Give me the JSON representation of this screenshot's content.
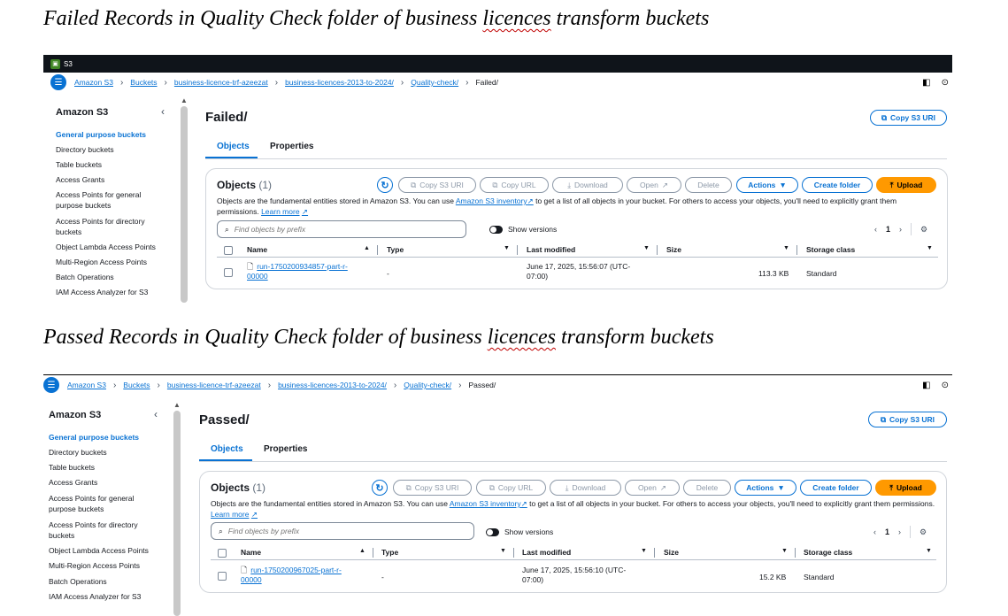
{
  "captions": {
    "failed": {
      "before": "Failed Records in Quality Check folder of business ",
      "squiggle": "licences",
      "after": " transform buckets"
    },
    "passed": {
      "before": "Passed Records in Quality Check folder of business ",
      "squiggle": "licences",
      "after": " transform buckets"
    }
  },
  "top_bar": {
    "service": "S3"
  },
  "failed_panel": {
    "breadcrumb": [
      "Amazon S3",
      "Buckets",
      "business-licence-trf-azeezat",
      "business-licences-2013-to-2024/",
      "Quality-check/"
    ],
    "breadcrumb_current": "Failed/",
    "page_title": "Failed/",
    "file_name_line1": "run-1750200934857-part-r-",
    "file_name_line2": "00000",
    "type": "-",
    "modified_line1": "June 17, 2025, 15:56:07 (UTC-",
    "modified_line2": "07:00)",
    "size": "113.3 KB",
    "storage_class": "Standard"
  },
  "passed_panel": {
    "breadcrumb": [
      "Amazon S3",
      "Buckets",
      "business-licence-trf-azeezat",
      "business-licences-2013-to-2024/",
      "Quality-check/"
    ],
    "breadcrumb_current": "Passed/",
    "page_title": "Passed/",
    "file_name_line1": "run-1750200967025-part-r-",
    "file_name_line2": "00000",
    "type": "-",
    "modified_line1": "June 17, 2025, 15:56:10 (UTC-",
    "modified_line2": "07:00)",
    "size": "15.2 KB",
    "storage_class": "Standard"
  },
  "sidebar": {
    "title": "Amazon S3",
    "items": [
      "General purpose buckets",
      "Directory buckets",
      "Table buckets",
      "Access Grants",
      "Access Points for general purpose buckets",
      "Access Points for directory buckets",
      "Object Lambda Access Points",
      "Multi-Region Access Points",
      "Batch Operations",
      "IAM Access Analyzer for S3"
    ]
  },
  "tabs": [
    "Objects",
    "Properties"
  ],
  "actions": {
    "copy_s3_uri": "Copy S3 URI",
    "copy_url": "Copy URL",
    "download": "Download",
    "open": "Open",
    "delete": "Delete",
    "actions": "Actions",
    "create_folder": "Create folder",
    "upload": "Upload"
  },
  "objects_card": {
    "title": "Objects",
    "count": "(1)",
    "desc_1": "Objects are the fundamental entities stored in Amazon S3. You can use ",
    "desc_link": "Amazon S3 inventory",
    "desc_2": " to get a list of all objects in your bucket. For others to access your objects, you'll need to explicitly grant them permissions. ",
    "learn_more": "Learn more",
    "search_placeholder": "Find objects by prefix",
    "show_versions": "Show versions",
    "page": "1"
  },
  "columns": [
    "Name",
    "Type",
    "Last modified",
    "Size",
    "Storage class"
  ],
  "colors": {
    "link": "#0972d3",
    "upload": "#ff9900",
    "topbar": "#0f141a",
    "squiggle": "#c00000"
  }
}
